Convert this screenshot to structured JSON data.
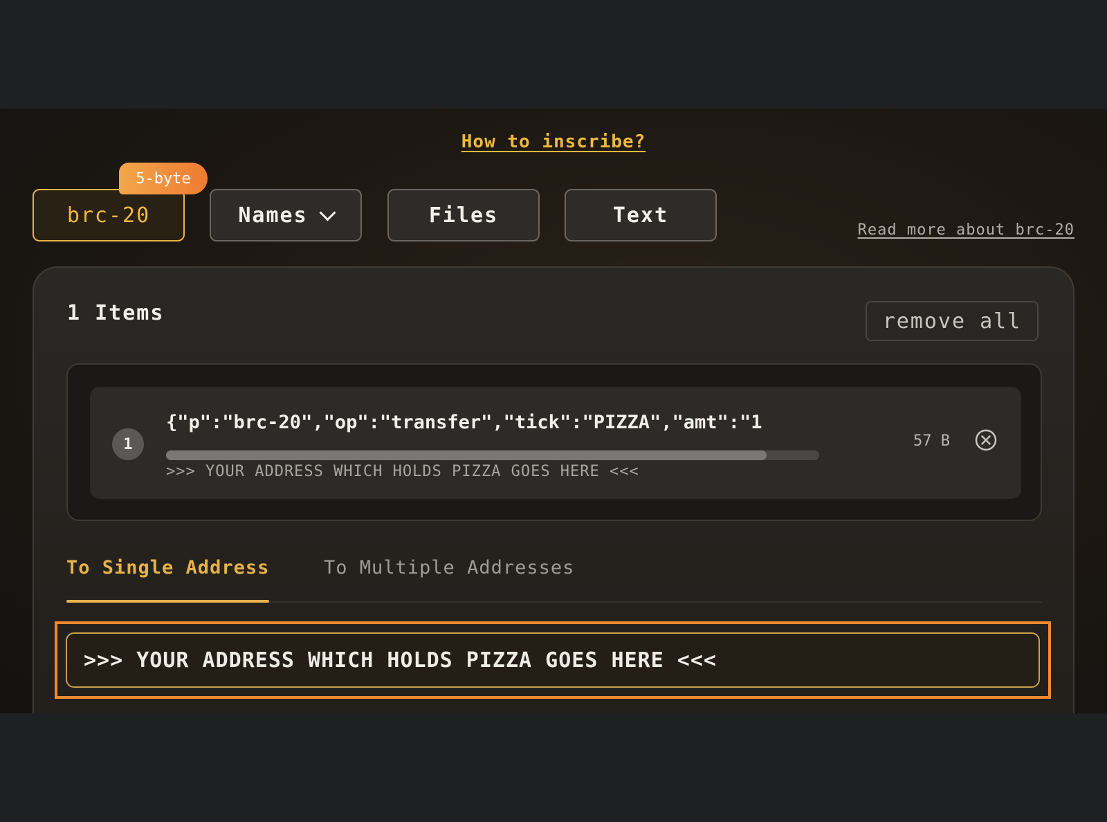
{
  "header": {
    "how_to_link": "How to inscribe?"
  },
  "type_tabs": [
    {
      "label": "brc-20",
      "active": true
    },
    {
      "label": "Names",
      "active": false
    },
    {
      "label": "Files",
      "active": false
    },
    {
      "label": "Text",
      "active": false
    }
  ],
  "badge": "5-byte",
  "read_more": "Read more about brc-20",
  "items_panel": {
    "title": "1 Items",
    "remove_all": "remove all",
    "items": [
      {
        "index": "1",
        "content": "{\"p\":\"brc-20\",\"op\":\"transfer\",\"tick\":\"PIZZA\",\"amt\":\"1",
        "progress": 0.92,
        "address": ">>> YOUR ADDRESS WHICH HOLDS PIZZA GOES HERE <<<",
        "size": "57 B"
      }
    ]
  },
  "destination": {
    "tabs": [
      {
        "label": "To Single Address",
        "active": true
      },
      {
        "label": "To Multiple Addresses",
        "active": false
      }
    ],
    "address_value": ">>> YOUR ADDRESS WHICH HOLDS PIZZA GOES HERE <<<"
  },
  "colors": {
    "accent": "#f0b93e",
    "highlight": "#f08a2f",
    "badge": "#ee7b33"
  },
  "icons": {
    "names_dropdown": "chevron-down-icon",
    "remove_item": "close-circle-icon"
  }
}
